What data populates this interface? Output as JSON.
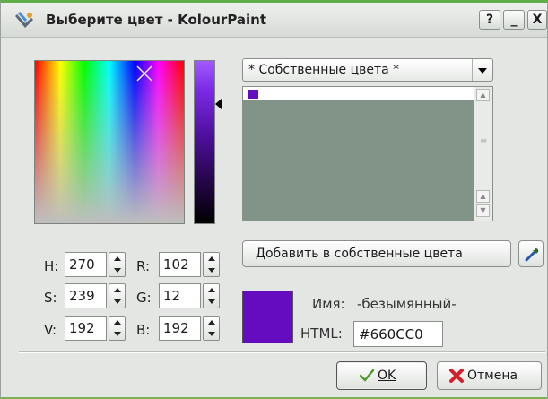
{
  "window": {
    "title": "Выберите цвет - KolourPaint",
    "buttons": {
      "help": "?",
      "minimize": "_",
      "close": "X"
    }
  },
  "palette_combo": {
    "selected": "* Собственные цвета *"
  },
  "spinners": {
    "h": {
      "label": "H:",
      "value": "270"
    },
    "s": {
      "label": "S:",
      "value": "239"
    },
    "v": {
      "label": "V:",
      "value": "192"
    },
    "r": {
      "label": "R:",
      "value": "102"
    },
    "g": {
      "label": "G:",
      "value": "12"
    },
    "b": {
      "label": "B:",
      "value": "192"
    }
  },
  "add_button": {
    "label": "Добавить в собственные цвета"
  },
  "current_color": {
    "hex_color": "#660cc0",
    "name_label": "Имя:",
    "name_value": "-безымянный-",
    "html_label": "HTML:",
    "html_value": "#660CC0"
  },
  "footer": {
    "ok_label": "OK",
    "cancel_label": "Отмена"
  },
  "icons": {
    "app": "kolourpaint-icon",
    "picker": "eyedropper-icon",
    "ok": "checkmark-icon",
    "cancel": "red-x-icon"
  }
}
